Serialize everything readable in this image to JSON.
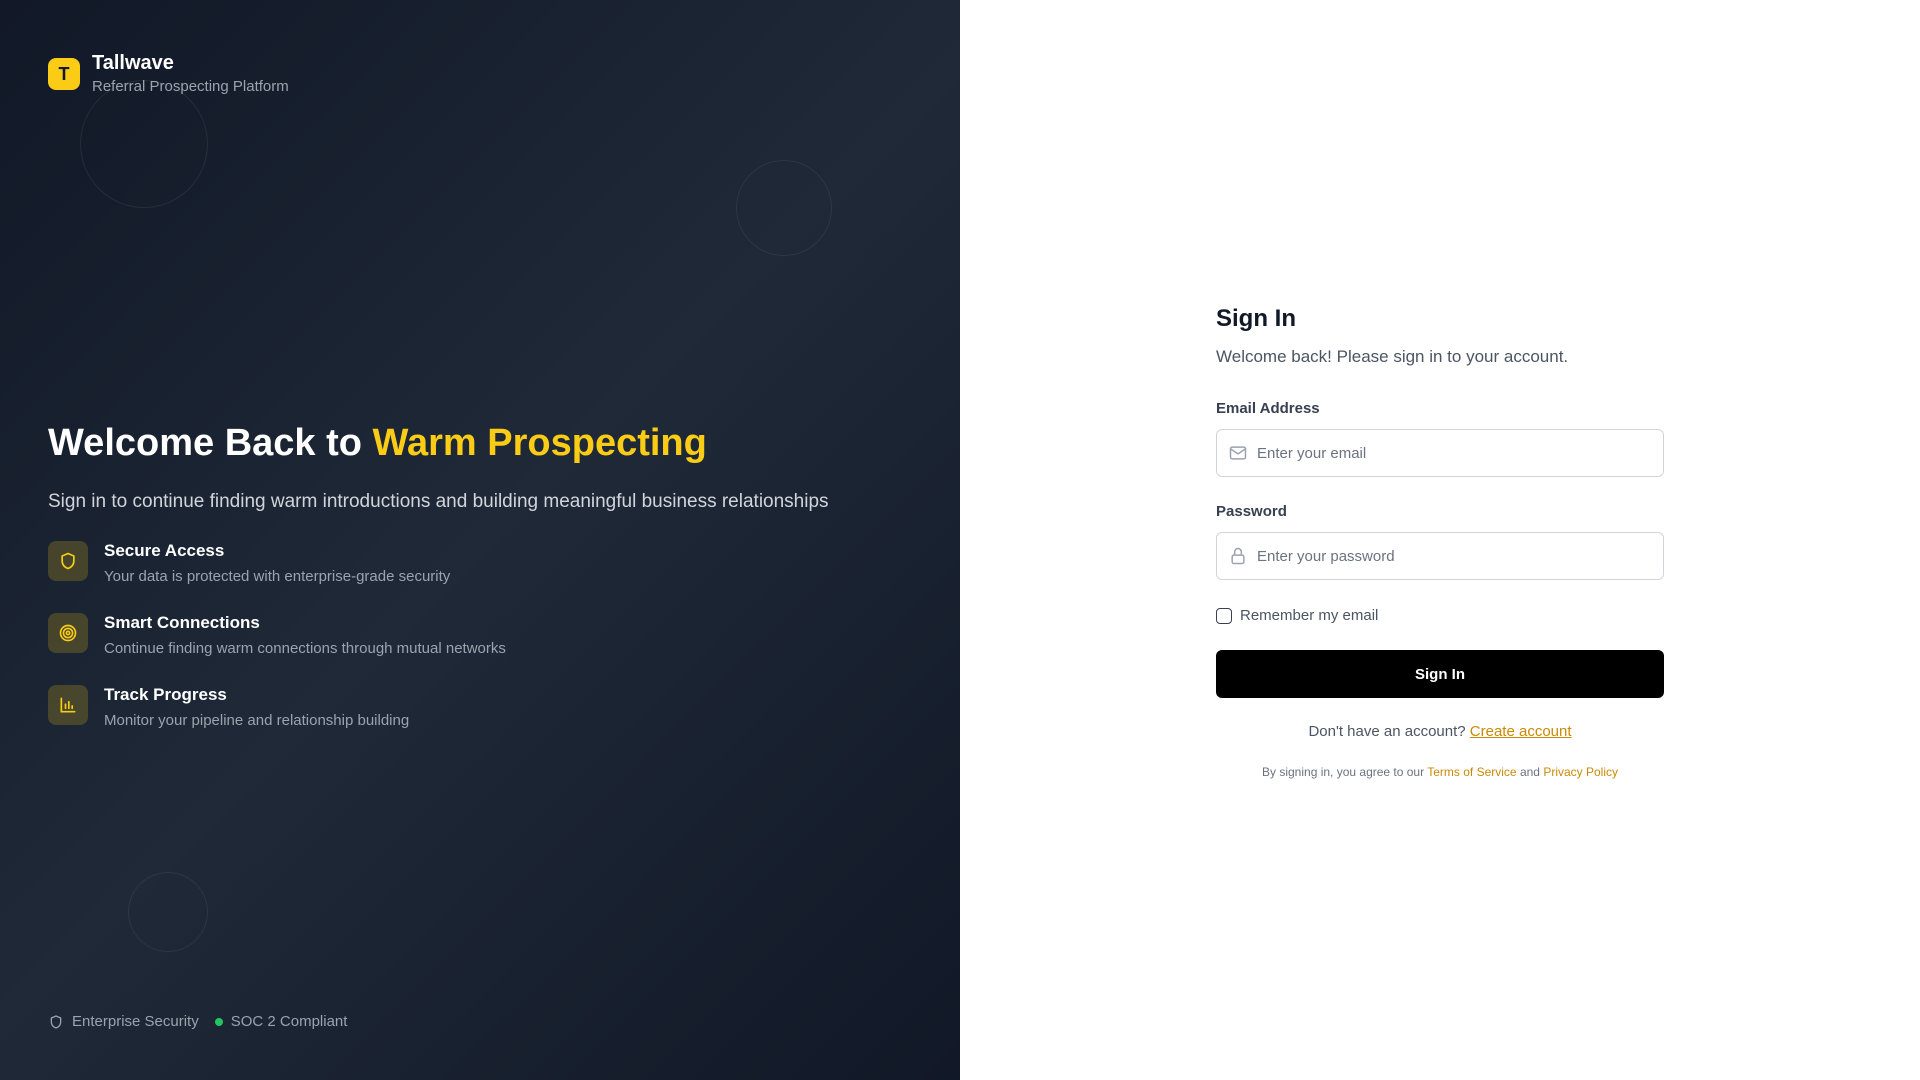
{
  "colors": {
    "accent": "#facc15",
    "accent_link": "#ca8a04",
    "panel_dark": "#111827",
    "button": "#000000",
    "status_green": "#22c55e"
  },
  "brand": {
    "logo_letter": "T",
    "name": "Tallwave",
    "tagline": "Referral Prospecting Platform"
  },
  "hero": {
    "title_prefix": "Welcome Back to ",
    "title_accent": "Warm Prospecting",
    "subtitle": "Sign in to continue finding warm introductions and building meaningful business relationships"
  },
  "features": [
    {
      "icon": "shield-icon",
      "title": "Secure Access",
      "description": "Your data is protected with enterprise-grade security"
    },
    {
      "icon": "target-icon",
      "title": "Smart Connections",
      "description": "Continue finding warm connections through mutual networks"
    },
    {
      "icon": "bar-chart-icon",
      "title": "Track Progress",
      "description": "Monitor your pipeline and relationship building"
    }
  ],
  "footer_badges": {
    "enterprise": "Enterprise Security",
    "soc": "SOC 2 Compliant"
  },
  "form": {
    "title": "Sign In",
    "subtitle": "Welcome back! Please sign in to your account.",
    "email_label": "Email Address",
    "email_placeholder": "Enter your email",
    "email_value": "",
    "password_label": "Password",
    "password_placeholder": "Enter your password",
    "password_value": "",
    "remember_label": "Remember my email",
    "remember_checked": false,
    "submit_label": "Sign In",
    "signup_prompt": "Don't have an account?",
    "signup_link": "Create account",
    "legal_prefix": "By signing in, you agree to our",
    "terms_link": "Terms of Service",
    "legal_and": "and",
    "privacy_link": "Privacy Policy"
  }
}
